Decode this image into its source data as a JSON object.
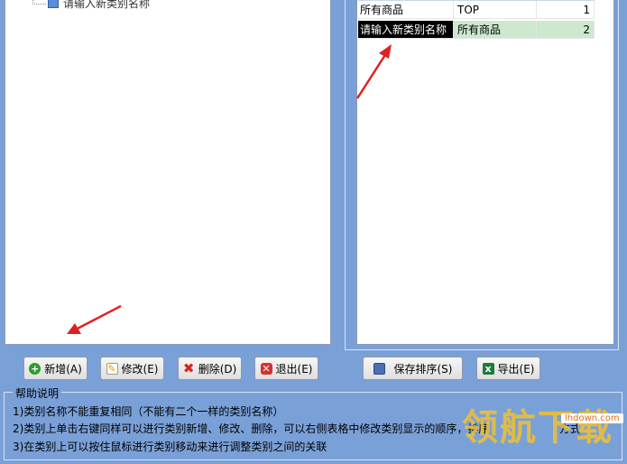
{
  "tree": {
    "node_label": "请输入新类别名称"
  },
  "grid": {
    "rows": [
      {
        "name": "所有商品",
        "parent": "TOP",
        "order": "1"
      },
      {
        "name": "请输入新类别名称",
        "parent": "所有商品",
        "order": "2"
      }
    ]
  },
  "buttons": {
    "add": "新增(A)",
    "edit": "修改(E)",
    "delete": "删除(D)",
    "exit": "退出(E)",
    "save_order": "保存排序(S)",
    "export": "导出(E)"
  },
  "help": {
    "title": "帮助说明",
    "lines": [
      "1)类别名称不能重复相同（不能有二个一样的类别名称）",
      "2)类别上单击右键同样可以进行类别新增、修改、删除，可以右侧表格中修改类别显示的顺序，排序",
      "3)在类别上可以按住鼠标进行类别移动来进行调整类别之间的关联"
    ],
    "line2_tail": "方式"
  },
  "watermark": {
    "url": "lhdown.com",
    "logo": "领航下载"
  },
  "colors": {
    "background": "#7aa0d8",
    "arrow": "#e02020",
    "selected_row": "#cde8cd"
  }
}
